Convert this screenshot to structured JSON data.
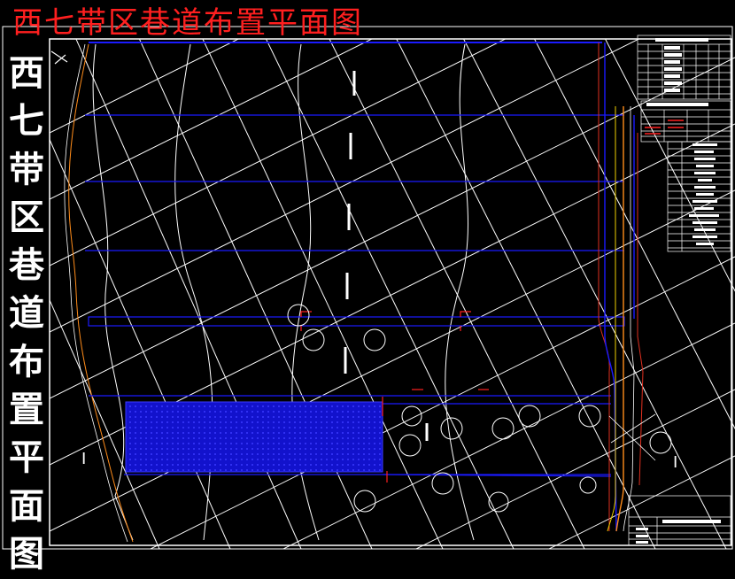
{
  "title": "西七带区巷道布置平面图",
  "vertical_title": [
    "西",
    "七",
    "带",
    "区",
    "巷",
    "道",
    "布",
    "置",
    "平",
    "面",
    "图"
  ],
  "section_marker_left": "I",
  "section_marker_right": "I",
  "colors": {
    "background": "#000000",
    "title": "#ff1f1f",
    "grid": "#ffffff",
    "roadway": "#1a1aff",
    "goaf_fill": "#1010d0",
    "boundary_orange": "#ff8c1a",
    "boundary_red": "#e03020",
    "yellow_line": "#f0d000"
  }
}
